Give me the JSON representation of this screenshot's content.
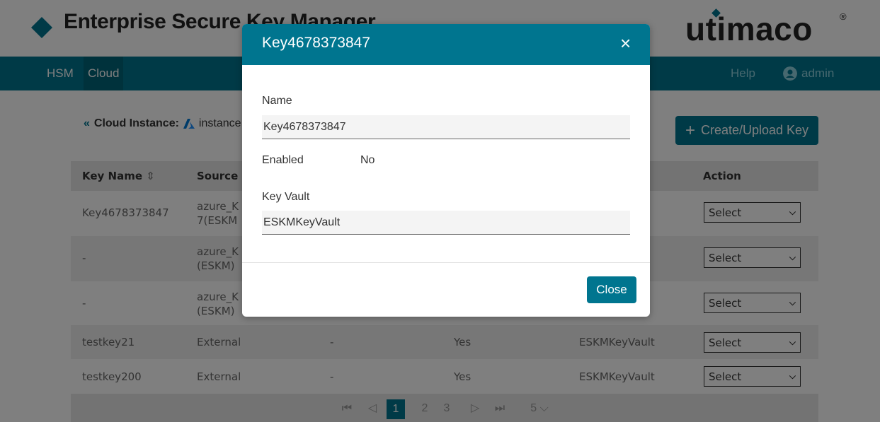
{
  "header": {
    "title": "Enterprise Secure Key Manager",
    "logo": "utimaco",
    "logo_reg": "®"
  },
  "nav": {
    "items": [
      "HSM",
      "Cloud"
    ],
    "help": "Help",
    "user": "admin"
  },
  "breadcrumb": {
    "back_icon": "double-chevron-left-icon",
    "label": "Cloud Instance:",
    "instance": "instance"
  },
  "create_button": {
    "label": "Create/Upload Key"
  },
  "table": {
    "headers": {
      "key_name": "Key Name",
      "source": "Source",
      "action": "Action"
    },
    "rows": [
      {
        "key_name": "Key4678373847",
        "source": "azure_K\n7(ESKM",
        "enabled": "",
        "key_vault": "",
        "action": "Select"
      },
      {
        "key_name": "-",
        "source": "azure_K\n(ESKM)",
        "enabled": "",
        "key_vault": "",
        "action": "Select"
      },
      {
        "key_name": "-",
        "source": "azure_K\n(ESKM)",
        "enabled": "",
        "key_vault": "",
        "action": "Select"
      },
      {
        "key_name": "testkey21",
        "source": "External",
        "col3": "-",
        "enabled": "Yes",
        "key_vault": "ESKMKeyVault",
        "action": "Select"
      },
      {
        "key_name": "testkey200",
        "source": "External",
        "col3": "-",
        "enabled": "Yes",
        "key_vault": "ESKMKeyVault",
        "action": "Select"
      }
    ]
  },
  "pagination": {
    "pages": [
      "1",
      "2",
      "3"
    ],
    "current": "1",
    "page_size": "5"
  },
  "modal": {
    "title": "Key4678373847",
    "close_icon": "×",
    "name_label": "Name",
    "name_value": "Key4678373847",
    "enabled_label": "Enabled",
    "enabled_value": "No",
    "vault_label": "Key Vault",
    "vault_value": "ESKMKeyVault",
    "close_button": "Close"
  },
  "colors": {
    "accent": "#00758f",
    "overlay": "rgba(0,0,0,0.5)"
  }
}
